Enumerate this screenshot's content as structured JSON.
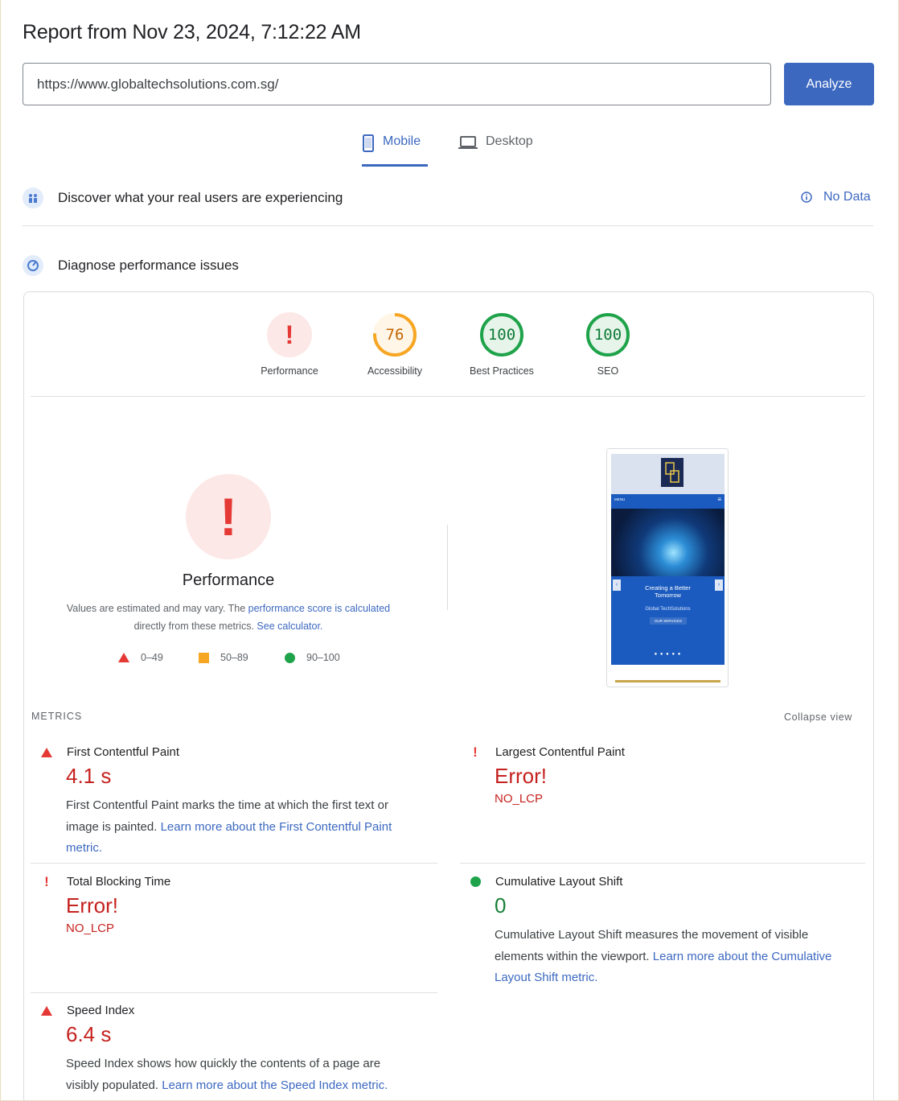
{
  "report": {
    "title": "Report from Nov 23, 2024, 7:12:22 AM"
  },
  "search": {
    "url": "https://www.globaltechsolutions.com.sg/",
    "analyze_label": "Analyze"
  },
  "tabs": [
    {
      "label": "Mobile",
      "active": true,
      "icon": "smartphone-icon"
    },
    {
      "label": "Desktop",
      "active": false,
      "icon": "laptop-icon"
    }
  ],
  "sections": {
    "real_users": {
      "title": "Discover what your real users are experiencing",
      "status": "No Data"
    },
    "diagnose": {
      "title": "Diagnose performance issues"
    }
  },
  "scores": [
    {
      "label": "Performance",
      "value": "!",
      "status": "error",
      "color": "#e53935"
    },
    {
      "label": "Accessibility",
      "value": "76",
      "status": "average",
      "fraction": 0.76,
      "color": "#f6a623"
    },
    {
      "label": "Best Practices",
      "value": "100",
      "status": "good",
      "fraction": 1.0,
      "color": "#1fa34a"
    },
    {
      "label": "SEO",
      "value": "100",
      "status": "good",
      "fraction": 1.0,
      "color": "#1fa34a"
    }
  ],
  "performance": {
    "title": "Performance",
    "icon": "!",
    "explain_prefix": "Values are estimated and may vary. The ",
    "explain_link": "performance score is calculated",
    "explain_middle": "directly from these metrics. ",
    "calculator_link": "See calculator.",
    "legend": [
      {
        "shape": "triangle",
        "range": "0–49",
        "color": "#e53935"
      },
      {
        "shape": "square",
        "range": "50–89",
        "color": "#f6a623"
      },
      {
        "shape": "circle",
        "range": "90–100",
        "color": "#1fa34a"
      }
    ]
  },
  "thumbnail": {
    "menu_label": "MENU",
    "hero_title_1": "Creating a Better",
    "hero_title_2": "Tomorrow",
    "hero_sub": "Global TechSolutions",
    "hero_button": "OUR SERVICES"
  },
  "metrics": {
    "heading": "METRICS",
    "collapse_label": "Collapse view",
    "items": [
      {
        "name": "First Contentful Paint",
        "indicator": "triangle",
        "value": "4.1 s",
        "desc": "First Contentful Paint marks the time at which the first text or image is painted. ",
        "link": "Learn more about the First Contentful Paint metric."
      },
      {
        "name": "Largest Contentful Paint",
        "indicator": "error",
        "value": "Error!",
        "sub": "NO_LCP"
      },
      {
        "name": "Total Blocking Time",
        "indicator": "error",
        "value": "Error!",
        "sub": "NO_LCP"
      },
      {
        "name": "Cumulative Layout Shift",
        "indicator": "circle",
        "value": "0",
        "desc": "Cumulative Layout Shift measures the movement of visible elements within the viewport. ",
        "link": "Learn more about the Cumulative Layout Shift metric."
      },
      {
        "name": "Speed Index",
        "indicator": "triangle",
        "value": "6.4 s",
        "desc": "Speed Index shows how quickly the contents of a page are visibly populated. ",
        "link": "Learn more about the Speed Index metric."
      }
    ]
  }
}
